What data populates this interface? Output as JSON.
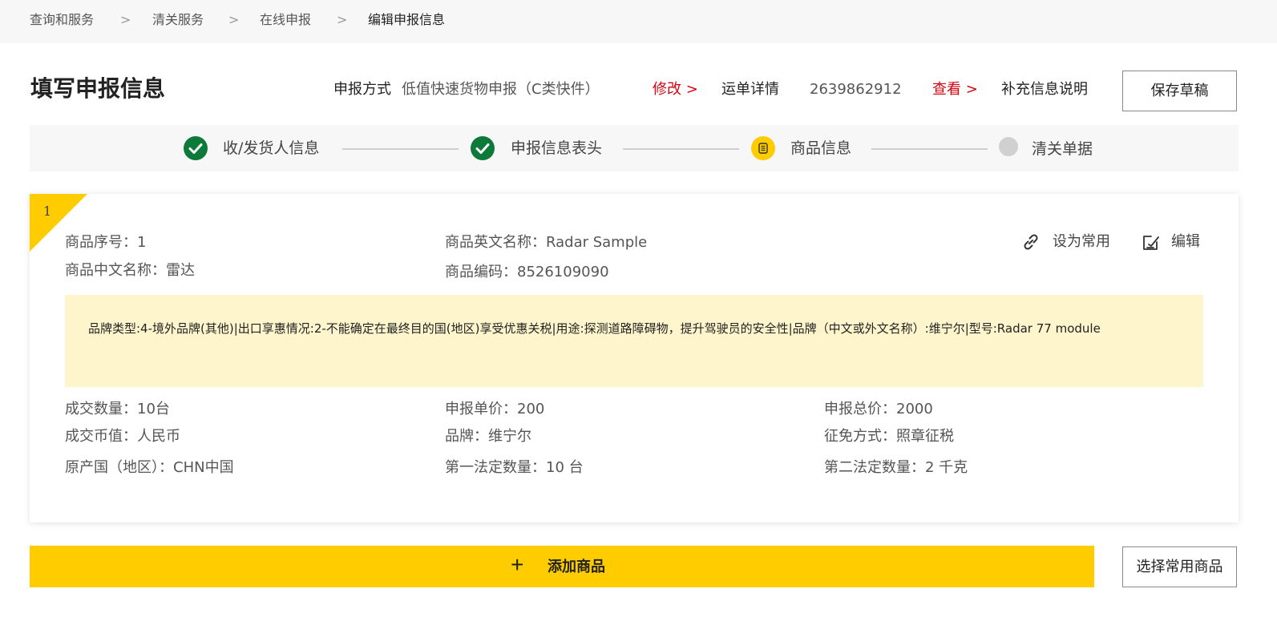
{
  "breadcrumb": {
    "items": [
      "查询和服务",
      "清关服务",
      "在线申报",
      "编辑申报信息"
    ],
    "separator": ">"
  },
  "header": {
    "title": "填写申报信息",
    "method_label": "申报方式",
    "method_value": "低值快速货物申报（C类快件）",
    "modify_link": "修改 >",
    "waybill_label": "运单详情",
    "waybill_number": "2639862912",
    "view_link": "查看 >",
    "supplement_label": "补充信息说明",
    "save_draft": "保存草稿"
  },
  "steps": [
    {
      "label": "收/发货人信息",
      "state": "done"
    },
    {
      "label": "申报信息表头",
      "state": "done"
    },
    {
      "label": "商品信息",
      "state": "active"
    },
    {
      "label": "清关单据",
      "state": "todo"
    }
  ],
  "item": {
    "index": "1",
    "seq": "商品序号：1",
    "name_en": "商品英文名称：Radar Sample",
    "name_cn": "商品中文名称：雷达",
    "code": "商品编码：8526109090",
    "set_common": "设为常用",
    "edit": "编辑",
    "description": "品牌类型:4-境外品牌(其他)|出口享惠情况:2-不能确定在最终目的国(地区)享受优惠关税|用途:探测道路障碍物，提升驾驶员的安全性|品牌（中文或外文名称）:维宁尔|型号:Radar 77 module",
    "fields": {
      "qty": "成交数量：10台",
      "unit_price": "申报单价：200",
      "total_price": "申报总价：2000",
      "currency": "成交币值：人民币",
      "brand": "品牌：维宁尔",
      "levy": "征免方式：照章征税",
      "origin": "原产国（地区）：CHN中国",
      "legal_qty1": "第一法定数量：10 台",
      "legal_qty2": "第二法定数量：2 千克"
    }
  },
  "actions": {
    "add_plus": "+",
    "add_product": "添加商品",
    "select_common": "选择常用商品"
  },
  "colors": {
    "accent_yellow": "#ffcc00",
    "link_red": "#d40511",
    "done_green": "#0d7a3a",
    "desc_bg": "#fff5cc"
  }
}
